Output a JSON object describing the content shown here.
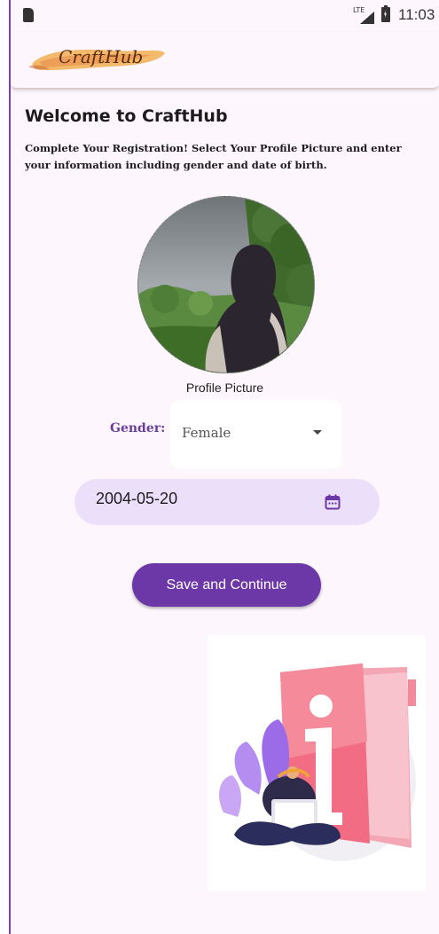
{
  "status_bar": {
    "network_label": "LTE",
    "time": "11:03",
    "icons": [
      "sd-card-icon",
      "signal-icon",
      "battery-charging-icon"
    ]
  },
  "app_bar": {
    "logo_text": "CraftHub"
  },
  "header": {
    "title": "Welcome to CraftHub",
    "subtitle": "Complete Your Registration! Select Your Profile Picture and enter your information including gender and date of birth."
  },
  "profile": {
    "label": "Profile Picture"
  },
  "gender": {
    "label": "Gender:",
    "selected": "Female"
  },
  "dob": {
    "value": "2004-05-20",
    "icon": "calendar-icon"
  },
  "actions": {
    "save_label": "Save and Continue"
  },
  "colors": {
    "accent": "#6c37a6",
    "date_field_bg": "#ebdff9",
    "background": "#fdf7fd",
    "gender_label": "#6a3d9a"
  }
}
